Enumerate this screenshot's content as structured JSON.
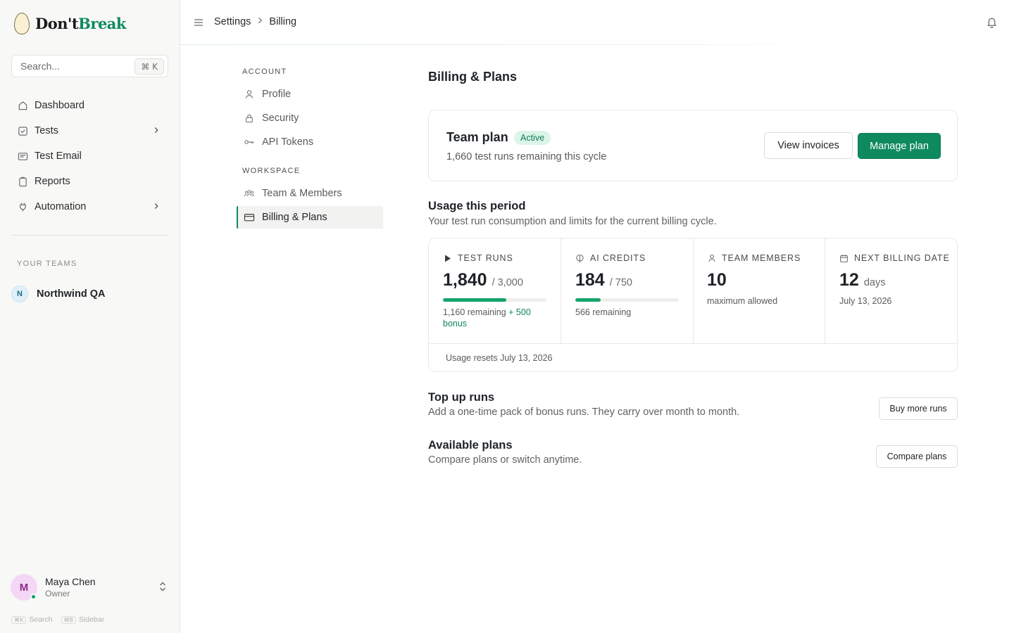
{
  "brand": {
    "name_part1": "Don't",
    "name_part2": "Break",
    "accent_color": "#0f8a5f"
  },
  "sidebar": {
    "search": {
      "placeholder": "Search...",
      "shortcut": "⌘ K"
    },
    "items": [
      {
        "label": "Dashboard",
        "icon": "home-icon"
      },
      {
        "label": "Tests",
        "icon": "check-square-icon",
        "has_children": true
      },
      {
        "label": "Test Email",
        "icon": "mail-icon"
      },
      {
        "label": "Reports",
        "icon": "clipboard-icon"
      },
      {
        "label": "Automation",
        "icon": "plug-icon",
        "has_children": true
      }
    ],
    "teams_label": "YOUR TEAMS",
    "team": {
      "initial": "N",
      "name": "Northwind QA"
    },
    "user": {
      "initial": "M",
      "name": "Maya Chen",
      "role": "Owner"
    },
    "shortcuts": [
      {
        "key": "⌘K",
        "label": "Search"
      },
      {
        "key": "⌘B",
        "label": "Sidebar"
      }
    ]
  },
  "topbar": {
    "breadcrumb": [
      "Settings",
      "Billing"
    ]
  },
  "settings_nav": {
    "account_label": "ACCOUNT",
    "account_items": [
      {
        "label": "Profile",
        "icon": "user-icon"
      },
      {
        "label": "Security",
        "icon": "lock-icon"
      },
      {
        "label": "API Tokens",
        "icon": "key-icon"
      }
    ],
    "workspace_label": "WORKSPACE",
    "workspace_items": [
      {
        "label": "Team & Members",
        "icon": "users-icon"
      },
      {
        "label": "Billing & Plans",
        "icon": "credit-card-icon",
        "active": true
      }
    ]
  },
  "main": {
    "title": "Billing & Plans",
    "plan": {
      "name": "Team plan",
      "status": "Active",
      "subtitle": "1,660 test runs remaining this cycle",
      "view_invoices": "View invoices",
      "manage_plan": "Manage plan"
    },
    "usage": {
      "title": "Usage this period",
      "subtitle": "Your test run consumption and limits for the current billing cycle.",
      "stats": {
        "test_runs": {
          "label": "TEST RUNS",
          "value": "1,840",
          "limit": "/ 3,000",
          "progress": 0.613,
          "remaining": "1,160 remaining",
          "bonus": "+ 500 bonus"
        },
        "ai_credits": {
          "label": "AI CREDITS",
          "value": "184",
          "limit": "/ 750",
          "progress": 0.245,
          "remaining": "566 remaining"
        },
        "team_members": {
          "label": "TEAM MEMBERS",
          "value": "10",
          "note": "maximum allowed"
        },
        "next_billing": {
          "label": "NEXT BILLING DATE",
          "value": "12",
          "unit": "days",
          "date": "July 13, 2026"
        }
      },
      "reset_note": "Usage resets July 13, 2026"
    },
    "topup": {
      "title": "Top up runs",
      "subtitle": "Add a one-time pack of bonus runs. They carry over month to month.",
      "button": "Buy more runs"
    },
    "plans": {
      "title": "Available plans",
      "subtitle": "Compare plans or switch anytime.",
      "button": "Compare plans"
    }
  }
}
